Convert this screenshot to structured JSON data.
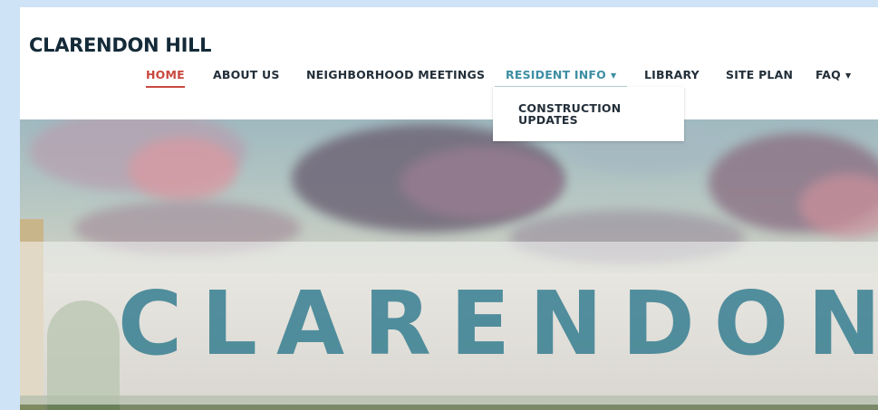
{
  "site": {
    "title": "CLARENDON HILL"
  },
  "nav": {
    "items": [
      {
        "label": "HOME"
      },
      {
        "label": "ABOUT US"
      },
      {
        "label": "NEIGHBORHOOD MEETINGS"
      },
      {
        "label": "RESIDENT INFO"
      },
      {
        "label": "LIBRARY"
      },
      {
        "label": "SITE PLAN"
      },
      {
        "label": "FAQ"
      }
    ],
    "caret": "▼"
  },
  "dropdown": {
    "items": [
      {
        "label": "CONSTRUCTION UPDATES"
      }
    ]
  },
  "hero": {
    "headline": "CLARENDON"
  },
  "colors": {
    "accent": "#c8473d",
    "open": "#3d8ea3",
    "title": "#142a38",
    "hero_text": "#2c788c"
  }
}
